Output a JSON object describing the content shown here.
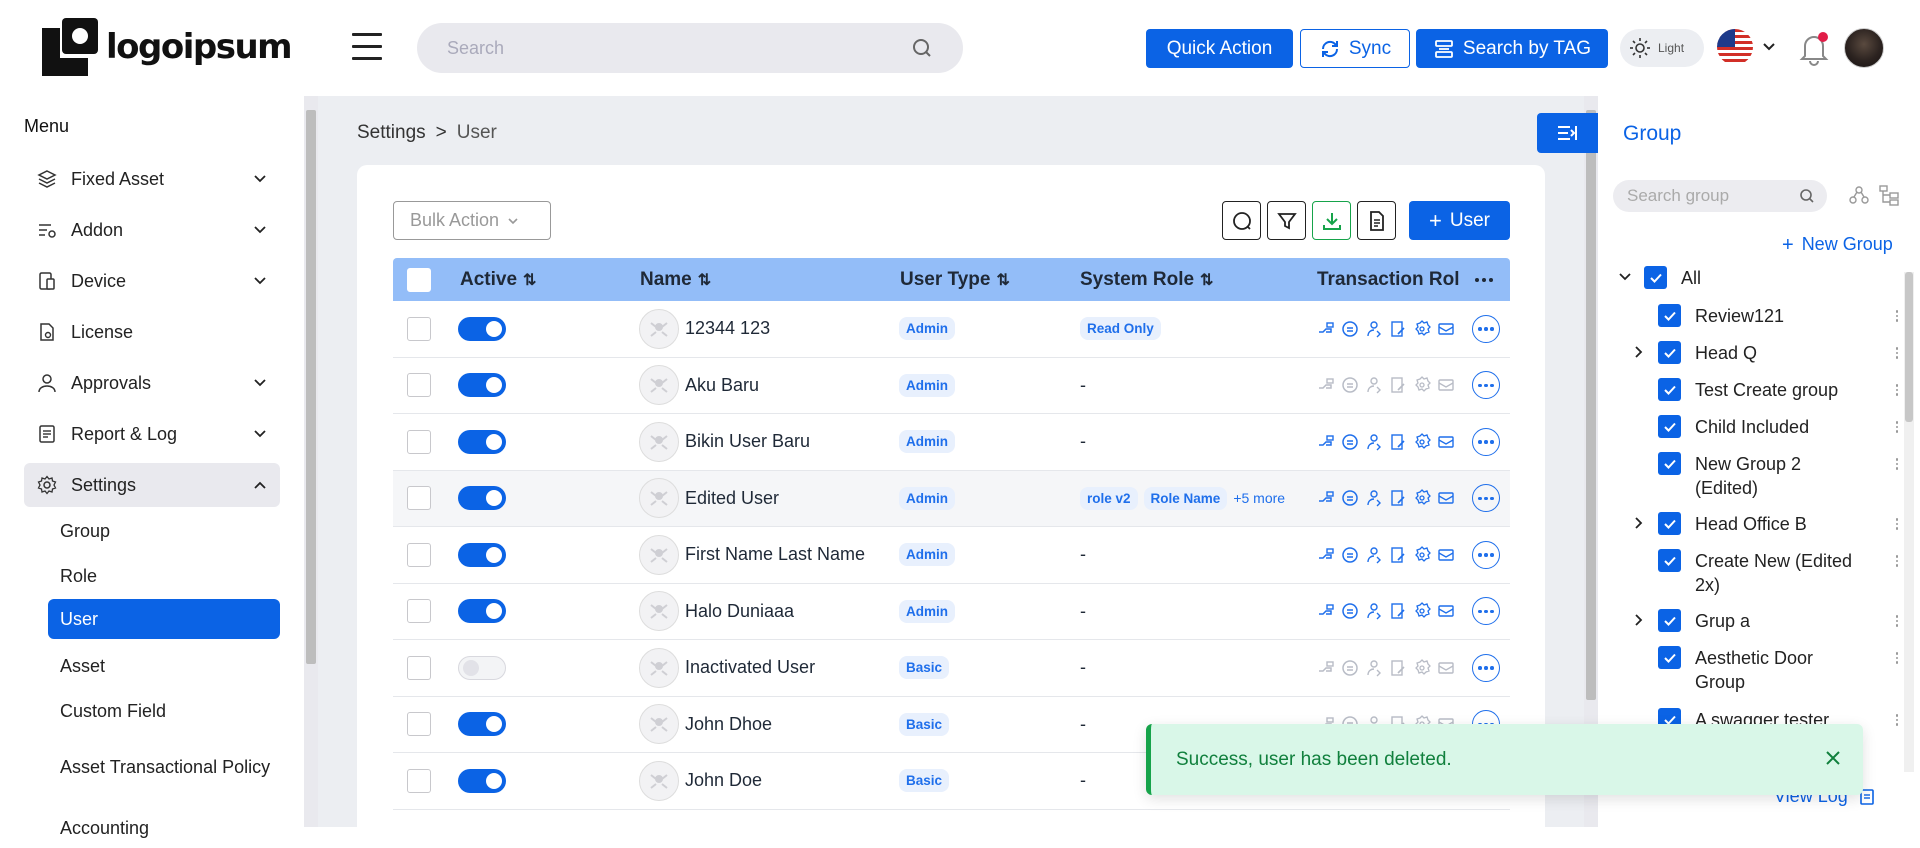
{
  "header": {
    "logo_text": "logoipsum",
    "search_placeholder": "Search",
    "quick_action_label": "Quick Action",
    "sync_label": "Sync",
    "search_by_tag_label": "Search by TAG",
    "theme_label": "Light"
  },
  "sidebar": {
    "menu_title": "Menu",
    "items": [
      {
        "label": "Fixed Asset",
        "icon": "layers-icon"
      },
      {
        "label": "Addon",
        "icon": "addon-icon"
      },
      {
        "label": "Device",
        "icon": "device-icon"
      },
      {
        "label": "License",
        "icon": "license-icon"
      },
      {
        "label": "Approvals",
        "icon": "user-icon"
      },
      {
        "label": "Report & Log",
        "icon": "report-icon"
      },
      {
        "label": "Settings",
        "icon": "gear-icon"
      }
    ],
    "settings_children": [
      "Group",
      "Role",
      "User",
      "Asset",
      "Custom Field",
      "Asset Transactional Policy",
      "Accounting"
    ]
  },
  "breadcrumb": {
    "parent": "Settings",
    "separator": ">",
    "current": "User"
  },
  "toolbar": {
    "bulk_action": "Bulk Action",
    "add_user": "User"
  },
  "table": {
    "columns": [
      "Active",
      "Name",
      "User Type",
      "System Role",
      "Transaction Rol"
    ],
    "rows": [
      {
        "active": true,
        "name": "12344 123",
        "user_type": "Admin",
        "system_role": [
          "Read Only"
        ],
        "system_role_more": "",
        "tx_active": true
      },
      {
        "active": true,
        "name": "Aku Baru",
        "user_type": "Admin",
        "system_role": [],
        "system_role_more": "-",
        "tx_active": false
      },
      {
        "active": true,
        "name": "Bikin User Baru",
        "user_type": "Admin",
        "system_role": [],
        "system_role_more": "-",
        "tx_active": true
      },
      {
        "active": true,
        "name": "Edited User",
        "user_type": "Admin",
        "system_role": [
          "role v2",
          "Role Name"
        ],
        "system_role_more": "+5 more",
        "tx_active": true
      },
      {
        "active": true,
        "name": "First Name Last Name",
        "user_type": "Admin",
        "system_role": [],
        "system_role_more": "-",
        "tx_active": true
      },
      {
        "active": true,
        "name": "Halo Duniaaa",
        "user_type": "Admin",
        "system_role": [],
        "system_role_more": "-",
        "tx_active": true
      },
      {
        "active": false,
        "name": "Inactivated User",
        "user_type": "Basic",
        "system_role": [],
        "system_role_more": "-",
        "tx_active": false
      },
      {
        "active": true,
        "name": "John Dhoe",
        "user_type": "Basic",
        "system_role": [],
        "system_role_more": "-",
        "tx_active": false
      },
      {
        "active": true,
        "name": "John Doe",
        "user_type": "Basic",
        "system_role": [],
        "system_role_more": "-",
        "tx_active": false
      }
    ]
  },
  "group_panel": {
    "title": "Group",
    "search_placeholder": "Search group",
    "new_group_label": "New Group",
    "items": [
      {
        "label": "All",
        "expandable": "down"
      },
      {
        "label": "Review121",
        "expandable": ""
      },
      {
        "label": "Head Q",
        "expandable": "right"
      },
      {
        "label": "Test Create group",
        "expandable": ""
      },
      {
        "label": "Child Included",
        "expandable": ""
      },
      {
        "label": "New Group 2 (Edited)",
        "expandable": ""
      },
      {
        "label": "Head Office B",
        "expandable": "right"
      },
      {
        "label": "Create New (Edited 2x)",
        "expandable": ""
      },
      {
        "label": "Grup a",
        "expandable": "right"
      },
      {
        "label": "Aesthetic Door Group",
        "expandable": ""
      },
      {
        "label": "A swagger tester",
        "expandable": ""
      }
    ],
    "view_log_label": "View Log"
  },
  "toast": {
    "message": "Success, user has been deleted."
  },
  "colors": {
    "primary": "#0b63e5",
    "header_row": "#93bdf8",
    "toast_bg": "#d9f7e8",
    "toast_accent": "#16a34a"
  }
}
